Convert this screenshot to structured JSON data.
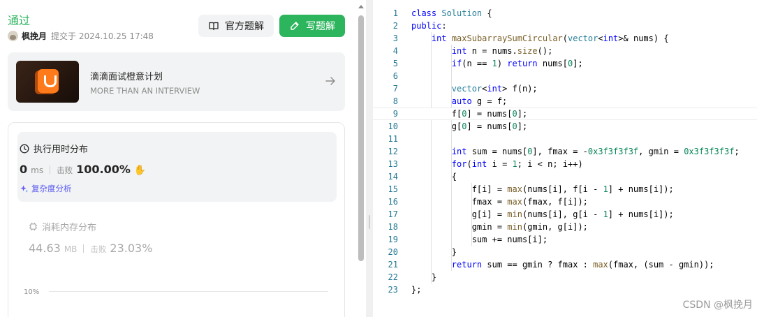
{
  "submission": {
    "status": "通过",
    "username": "枫挽月",
    "submitted_at": "提交于 2024.10.25 17:48",
    "official_solution_label": "官方题解",
    "write_solution_label": "写题解"
  },
  "banner": {
    "title": "滴滴面试橙意计划",
    "subtitle": "MORE THAN AN INTERVIEW"
  },
  "runtime": {
    "title": "执行用时分布",
    "value": "0",
    "unit": "ms",
    "beat_label": "击败",
    "beat_pct": "100.00%",
    "complexity_label": "复杂度分析"
  },
  "memory": {
    "title": "消耗内存分布",
    "value": "44.63",
    "unit": "MB",
    "beat_label": "击败",
    "beat_pct": "23.03%",
    "axis_tick": "10%"
  },
  "editor": {
    "active_line": 9,
    "lines": [
      "class Solution {",
      "public:",
      "    int maxSubarraySumCircular(vector<int>& nums) {",
      "        int n = nums.size();",
      "        if(n == 1) return nums[0];",
      "",
      "        vector<int> f(n);",
      "        auto g = f;",
      "        f[0] = nums[0];",
      "        g[0] = nums[0];",
      "",
      "        int sum = nums[0], fmax = -0x3f3f3f3f, gmin = 0x3f3f3f3f;",
      "        for(int i = 1; i < n; i++)",
      "        {",
      "            f[i] = max(nums[i], f[i - 1] + nums[i]);",
      "            fmax = max(fmax, f[i]);",
      "            g[i] = min(nums[i], g[i - 1] + nums[i]);",
      "            gmin = min(gmin, g[i]);",
      "            sum += nums[i];",
      "        }",
      "        return sum == gmin ? fmax : max(fmax, (sum - gmin));",
      "    }",
      "};"
    ]
  },
  "watermark": "CSDN @枫挽月",
  "colors": {
    "accent": "#2db55d",
    "link": "#5a5af0",
    "line_number": "#237893"
  }
}
